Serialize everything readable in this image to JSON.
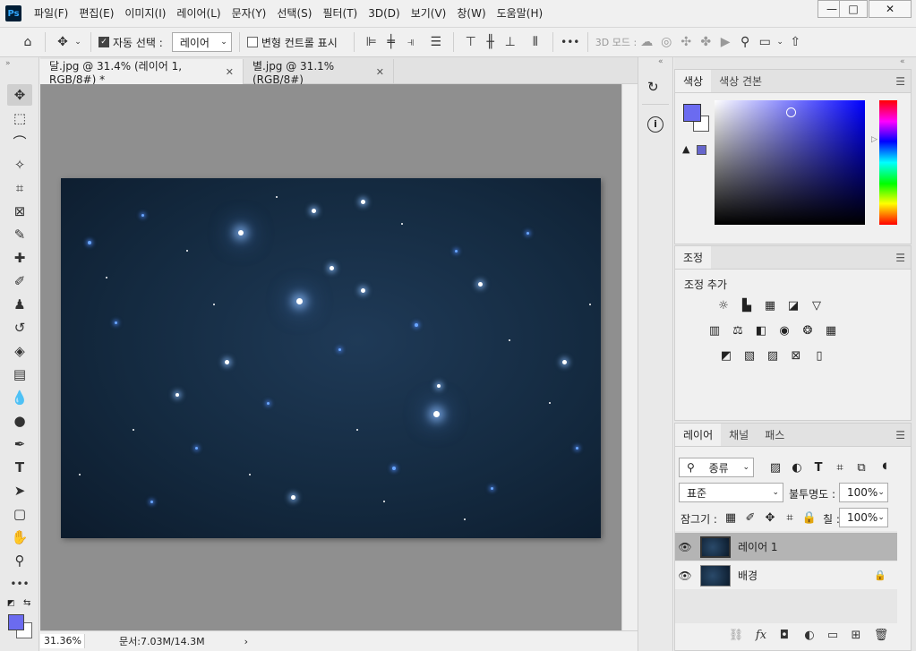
{
  "app": {
    "logo": "Ps"
  },
  "menu": [
    "파일(F)",
    "편집(E)",
    "이미지(I)",
    "레이어(L)",
    "문자(Y)",
    "선택(S)",
    "필터(T)",
    "3D(D)",
    "보기(V)",
    "창(W)",
    "도움말(H)"
  ],
  "window_controls": {
    "minimize": "—",
    "maximize": "□",
    "close": "✕"
  },
  "options": {
    "auto_select_label": "자동 선택 :",
    "auto_select_value": "레이어",
    "transform_label": "변형 컨트롤 표시",
    "more": "•••",
    "mode_3d_label": "3D 모드 :"
  },
  "tabs": [
    {
      "label": "달.jpg @ 31.4% (레이어 1, RGB/8#) *",
      "close": "✕"
    },
    {
      "label": "별.jpg @ 31.1% (RGB/8#)",
      "close": "✕"
    }
  ],
  "status": {
    "zoom": "31.36%",
    "doc": "문서:7.03M/14.3M",
    "arrow": "›"
  },
  "color_panel": {
    "tabs": [
      "색상",
      "색상 견본"
    ],
    "fg_color": "#6b6bf0",
    "bg_color": "#ffffff"
  },
  "adjust_panel": {
    "tab": "조정",
    "subtitle": "조정 추가"
  },
  "layers_panel": {
    "tabs": [
      "레이어",
      "채널",
      "패스"
    ],
    "filter_value": "종류",
    "blend_value": "표준",
    "opacity_label": "불투명도 :",
    "opacity_value": "100%",
    "lock_label": "잠그기 :",
    "fill_label": "칠 :",
    "fill_value": "100%",
    "layers": [
      {
        "name": "레이어 1",
        "selected": true
      },
      {
        "name": "배경",
        "locked": true
      }
    ],
    "footer_fx": "fx"
  },
  "colors": {
    "accent_fg": "#6b6bf0",
    "selected_layer": "#b4b4b4",
    "canvas_bg": "#8f8f8f"
  }
}
